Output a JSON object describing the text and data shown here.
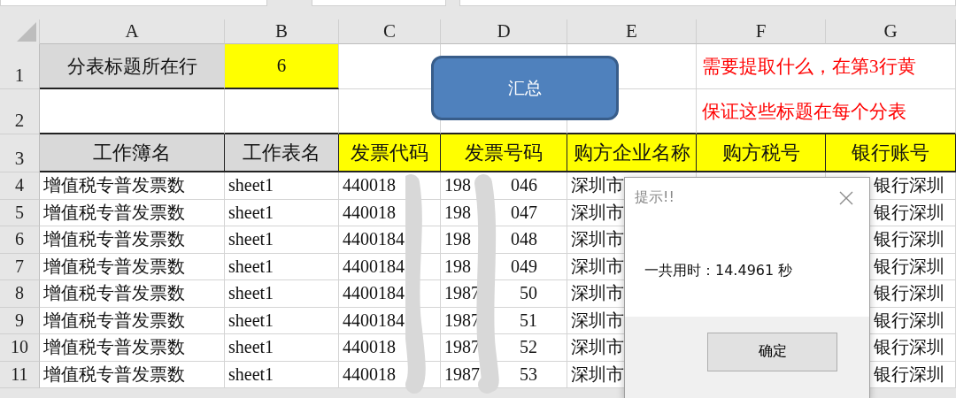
{
  "columns": [
    "A",
    "B",
    "C",
    "D",
    "E",
    "F",
    "G"
  ],
  "row_numbers": [
    "1",
    "2",
    "3"
  ],
  "settings": {
    "label": "分表标题所在行",
    "value": "6"
  },
  "action_button": "汇总",
  "notes": [
    "需要提取什么，在第3行黄",
    "保证这些标题在每个分表"
  ],
  "headers": [
    {
      "label": "工作簿名",
      "highlighted": false
    },
    {
      "label": "工作表名",
      "highlighted": false
    },
    {
      "label": "发票代码",
      "highlighted": true
    },
    {
      "label": "发票号码",
      "highlighted": true
    },
    {
      "label": "购方企业名称",
      "highlighted": true
    },
    {
      "label": "购方税号",
      "highlighted": true
    },
    {
      "label": "银行账号",
      "highlighted": true
    }
  ],
  "rows": [
    {
      "num": "4",
      "workbook": "增值税专普发票数",
      "sheet": "sheet1",
      "code": "440018",
      "number_start": "198",
      "number_end": "046",
      "buyer": "深圳市",
      "bank": "银行深圳"
    },
    {
      "num": "5",
      "workbook": "增值税专普发票数",
      "sheet": "sheet1",
      "code": "440018",
      "number_start": "198",
      "number_end": "047",
      "buyer": "深圳市",
      "bank": "银行深圳"
    },
    {
      "num": "6",
      "workbook": "增值税专普发票数",
      "sheet": "sheet1",
      "code": "4400184",
      "number_start": "198",
      "number_end": "048",
      "buyer": "深圳市",
      "bank": "银行深圳"
    },
    {
      "num": "7",
      "workbook": "增值税专普发票数",
      "sheet": "sheet1",
      "code": "4400184",
      "number_start": "198",
      "number_end": "049",
      "buyer": "深圳市",
      "bank": "银行深圳"
    },
    {
      "num": "8",
      "workbook": "增值税专普发票数",
      "sheet": "sheet1",
      "code": "4400184",
      "number_start": "1987",
      "number_end": "50",
      "buyer": "深圳市",
      "bank": "银行深圳"
    },
    {
      "num": "9",
      "workbook": "增值税专普发票数",
      "sheet": "sheet1",
      "code": "4400184",
      "number_start": "1987",
      "number_end": "51",
      "buyer": "深圳市",
      "bank": "银行深圳"
    },
    {
      "num": "10",
      "workbook": "增值税专普发票数",
      "sheet": "sheet1",
      "code": "440018",
      "number_start": "1987",
      "number_end": "52",
      "buyer": "深圳市",
      "bank": "银行深圳"
    },
    {
      "num": "11",
      "workbook": "增值税专普发票数",
      "sheet": "sheet1",
      "code": "440018",
      "number_start": "1987",
      "number_end": "53",
      "buyer": "深圳市",
      "bank": "银行深圳"
    }
  ],
  "dialog": {
    "title": "提示!!",
    "message": "一共用时：14.4961 秒",
    "ok": "确定"
  }
}
